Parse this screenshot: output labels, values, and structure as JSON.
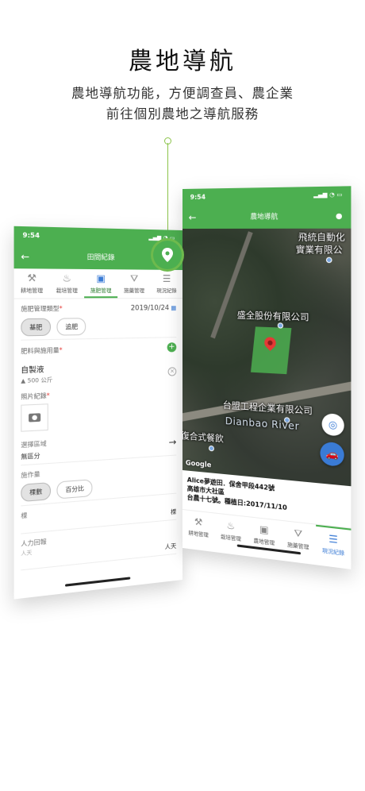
{
  "headline": "農地導航",
  "subtitle_line1": "農地導航功能，方便調查員、農企業",
  "subtitle_line2": "前往個別農地之導航服務",
  "left_phone": {
    "time": "9:54",
    "title": "田間紀錄",
    "tabs": [
      "耕地管理",
      "栽培管理",
      "施肥管理",
      "施藥管理",
      "現況紀錄"
    ],
    "active_tab": 2,
    "fert_type_label": "施肥管理類型",
    "date": "2019/10/24",
    "fert_chips": [
      "基肥",
      "追肥"
    ],
    "material_label": "肥料與施用量",
    "material_name": "自製液",
    "material_amount": "500 公斤",
    "photo_label": "照片紀錄",
    "area_label": "選擇區域",
    "area_value": "無區分",
    "work_amount_label": "施作量",
    "work_chips": [
      "棵數",
      "百分比"
    ],
    "unit_label": "棵",
    "unit_value": "棵",
    "labor_label": "人力回報",
    "labor_placeholder": "人天",
    "labor_value": "人天"
  },
  "right_phone": {
    "time": "9:54",
    "title": "農地導航",
    "map_labels": {
      "top_right_1": "飛統自動化",
      "top_right_2": "實業有限公",
      "company": "盛全股份有限公司",
      "company2": "台盟工程企業有限公司",
      "river": "Dianbao River",
      "restaurant": "復合式餐飲",
      "google": "Google"
    },
    "info_line1": "Alice夢遊田．保舍甲段442號",
    "info_line2": "高雄市大社區",
    "info_line3": "台農十七號。種植日:2017/11/10",
    "tabs": [
      "耕地管理",
      "栽培管理",
      "農地管理",
      "施藥管理",
      "現況紀錄"
    ],
    "active_tab": 4
  },
  "colors": {
    "brand_green": "#4caf50",
    "accent_blue": "#3a7bd5",
    "required_red": "#e53935"
  },
  "icons": [
    "location-pin-icon",
    "back-arrow-icon",
    "calendar-icon",
    "camera-icon",
    "add-icon",
    "clear-icon",
    "my-location-icon",
    "car-icon"
  ]
}
